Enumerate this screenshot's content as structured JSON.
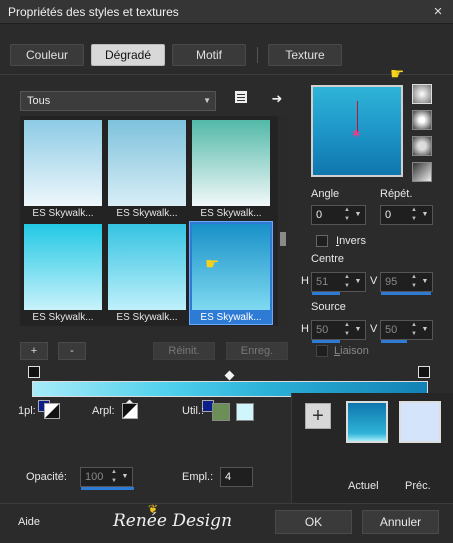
{
  "window": {
    "title": "Propriétés des styles et textures",
    "close_icon": "×"
  },
  "tabs": [
    {
      "label": "Couleur",
      "active": false
    },
    {
      "label": "Dégradé",
      "active": true
    },
    {
      "label": "Motif",
      "active": false
    },
    {
      "label": "Texture",
      "active": false
    }
  ],
  "library": {
    "category": "Tous",
    "presets": [
      {
        "label": "ES Skywalk...",
        "top": "#8dcbe5",
        "bottom": "#eef7fb"
      },
      {
        "label": "ES Skywalk...",
        "top": "#7ec2dc",
        "bottom": "#d8eef6"
      },
      {
        "label": "ES Skywalk...",
        "top": "#52b9a8",
        "bottom": "#f2f8f9"
      },
      {
        "label": "ES Skywalk...",
        "top": "#22c8e4",
        "bottom": "#c9f2fb"
      },
      {
        "label": "ES Skywalk...",
        "top": "#35c3e2",
        "bottom": "#bff0fb"
      },
      {
        "label": "ES Skywalk...",
        "top": "#1890c8",
        "bottom": "#7fd9f0",
        "selected": true
      }
    ],
    "add_label": "+",
    "remove_label": "-",
    "reset_label": "Réinit.",
    "save_label": "Enreg."
  },
  "gradient": {
    "angle_label": "Angle",
    "angle_value": "0",
    "repeat_label": "Répét.",
    "repeat_value": "0",
    "invert_label": "Invers",
    "invert_underline": "I",
    "center_label": "Centre",
    "center_h_label": "H",
    "center_h": "51",
    "center_v_label": "V",
    "center_v": "95",
    "source_label": "Source",
    "source_h_label": "H",
    "source_h": "50",
    "source_v_label": "V",
    "source_v": "50",
    "link_label": "Liaison",
    "link_underline": "L",
    "preview_colors": [
      "#2fb4d8",
      "#0f76ad"
    ]
  },
  "editor": {
    "one_pl_label": "1pl:",
    "arpl_label": "Arpl:",
    "util_label": "Util.:",
    "util_colors": [
      "#6c8f57",
      "#cff6fc"
    ],
    "opacity_label": "Opacité:",
    "opacity_value": "100",
    "empl_label": "Empl.:",
    "empl_value": "4"
  },
  "current": {
    "actuel_label": "Actuel",
    "prec_label": "Préc.",
    "actuel_color": "#1b9fd0",
    "prec_color": "#d4e5fb"
  },
  "footer": {
    "help_label": "Aide",
    "logo_text": "Renée Design",
    "ok_label": "OK",
    "cancel_label": "Annuler"
  }
}
